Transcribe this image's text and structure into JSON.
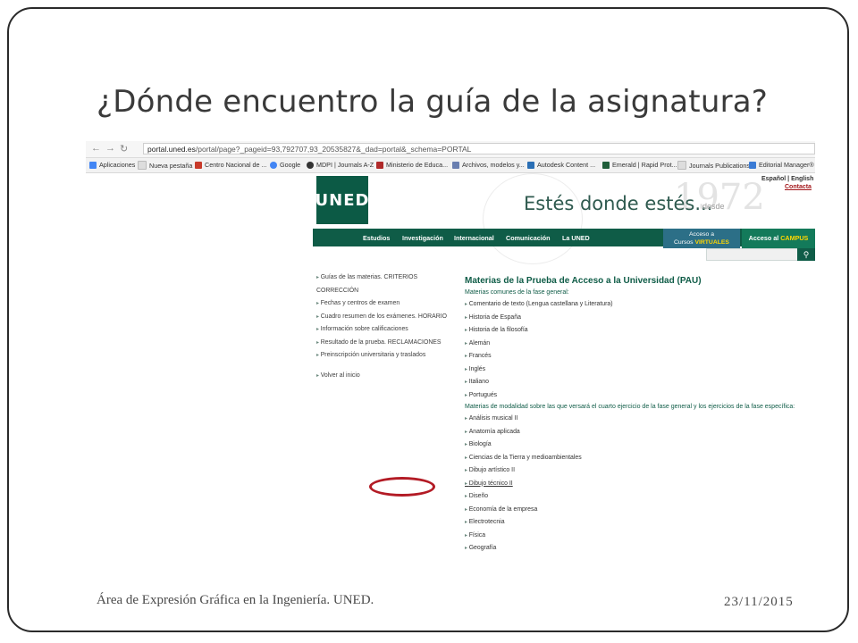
{
  "slide": {
    "title": "¿Dónde encuentro la guía de la asignatura?",
    "footer_left": "Área de Expresión Gráfica en la Ingeniería. UNED.",
    "footer_right": "23/11/2015"
  },
  "browser": {
    "url_host": "portal.uned.es",
    "url_rest": "/portal/page?_pageid=93,792707,93_20535827&_dad=portal&_schema=PORTAL",
    "bookmarks": [
      "Aplicaciones",
      "Nueva pestaña",
      "Centro Nacional de ...",
      "Google",
      "MDPI | Journals A-Z",
      "Ministerio de Educa...",
      "Archivos, modelos y...",
      "Autodesk Content ...",
      "Emerald | Rapid Prot...",
      "Journals Publications",
      "Editorial Manager®"
    ]
  },
  "site": {
    "logo": "UNED",
    "tagline": "Estés donde estés...",
    "desde": "desde",
    "year": "1972",
    "lang": "Español | English",
    "contact": "Contacta",
    "nav": [
      "Estudios",
      "Investigación",
      "Internacional",
      "Comunicación",
      "La UNED"
    ],
    "access_line1": "Acceso a",
    "access_line2_prefix": "Cursos",
    "access_line2_highlight": "VIRTUALES",
    "campus_prefix": "Acceso al",
    "campus_highlight": "CAMPUS"
  },
  "left_links": [
    "Guías de las materias. CRITERIOS CORRECCIÓN",
    "Fechas y centros de examen",
    "Cuadro resumen de los exámenes. HORARIO",
    "Información sobre calificaciones",
    "Resultado de la prueba. RECLAMACIONES",
    "Preinscripción universitaria y traslados",
    "Volver al inicio"
  ],
  "content": {
    "title": "Materias de la Prueba de Acceso a la Universidad (PAU)",
    "common_heading": "Materias comunes de la fase general:",
    "common_items": [
      "Comentario de texto (Lengua castellana y Literatura)",
      "Historia de España",
      "Historia de la filosofía",
      "Alemán",
      "Francés",
      "Inglés",
      "Italiano",
      "Portugués"
    ],
    "modality_heading": "Materias de modalidad sobre las que versará el cuarto ejercicio de la fase general y los ejercicios de la fase específica:",
    "modality_items": [
      "Análisis musical II",
      "Anatomía aplicada",
      "Biología",
      "Ciencias de la Tierra y medioambientales",
      "Dibujo artístico II",
      "Dibujo técnico II",
      "Diseño",
      "Economía de la empresa",
      "Electrotecnia",
      "Física",
      "Geografía"
    ]
  },
  "colors": {
    "uned_green": "#0f5c47",
    "highlight_circle": "#b31b25"
  }
}
